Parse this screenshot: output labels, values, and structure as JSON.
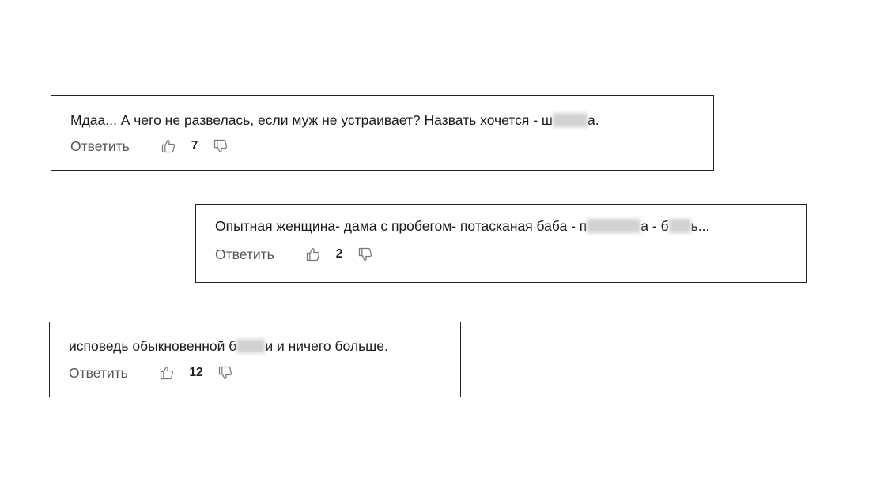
{
  "comments": [
    {
      "text_before": "Мдаа... А чего не развелась, если муж не устраивает? Назвать хочется - ш",
      "redacted": "",
      "text_after": "а.",
      "reply_label": "Ответить",
      "likes": "7"
    },
    {
      "text_before": "Опытная женщина- дама с пробегом- потасканая баба - п",
      "redacted": "",
      "text_mid": "а - б",
      "redacted2": "",
      "text_after": "ь...",
      "reply_label": "Ответить",
      "likes": "2"
    },
    {
      "text_before": "исповедь обыкновенной б",
      "redacted": "",
      "text_after": "и и ничего больше.",
      "reply_label": "Ответить",
      "likes": "12"
    }
  ],
  "icons": {
    "like": "thumbs-up-icon",
    "dislike": "thumbs-down-icon"
  },
  "colors": {
    "border": "#222222",
    "text": "#1a1a1a",
    "reply": "#555555",
    "icon": "#777777"
  }
}
